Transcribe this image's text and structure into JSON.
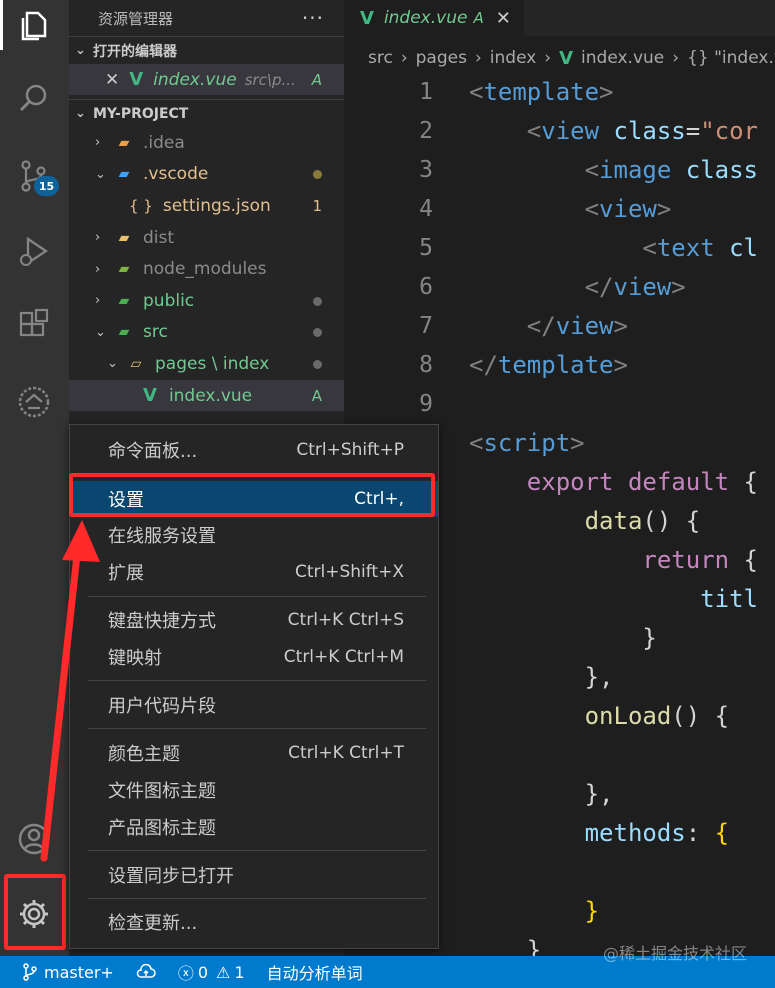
{
  "sidebar": {
    "title": "资源管理器",
    "more": "···",
    "open_editors_label": "打开的编辑器",
    "open_editor": {
      "name": "index.vue",
      "path": "src\\p...",
      "status": "A"
    },
    "project_label": "MY-PROJECT",
    "tree": [
      {
        "name": ".idea",
        "status": ""
      },
      {
        "name": ".vscode",
        "status": ""
      },
      {
        "name": "settings.json",
        "status": "1"
      },
      {
        "name": "dist",
        "status": ""
      },
      {
        "name": "node_modules",
        "status": ""
      },
      {
        "name": "public",
        "status": ""
      },
      {
        "name": "src",
        "status": ""
      },
      {
        "name": "pages \\ index",
        "status": ""
      },
      {
        "name": "index.vue",
        "status": "A"
      }
    ]
  },
  "activity": {
    "scm_badge": "15"
  },
  "editor": {
    "tab": {
      "name": "index.vue",
      "status": "A"
    },
    "breadcrumb": [
      "src",
      "pages",
      "index",
      "index.vue",
      "{} \"index.vue"
    ],
    "line_numbers": [
      "1",
      "2",
      "3",
      "4",
      "5",
      "6",
      "7",
      "8",
      "9"
    ]
  },
  "menu": {
    "items": [
      {
        "label": "命令面板...",
        "shortcut": "Ctrl+Shift+P"
      },
      {
        "label": "设置",
        "shortcut": "Ctrl+,"
      },
      {
        "label": "在线服务设置",
        "shortcut": ""
      },
      {
        "label": "扩展",
        "shortcut": "Ctrl+Shift+X"
      },
      {
        "label": "键盘快捷方式",
        "shortcut": "Ctrl+K Ctrl+S"
      },
      {
        "label": "键映射",
        "shortcut": "Ctrl+K Ctrl+M"
      },
      {
        "label": "用户代码片段",
        "shortcut": ""
      },
      {
        "label": "颜色主题",
        "shortcut": "Ctrl+K Ctrl+T"
      },
      {
        "label": "文件图标主题",
        "shortcut": ""
      },
      {
        "label": "产品图标主题",
        "shortcut": ""
      },
      {
        "label": "设置同步已打开",
        "shortcut": ""
      },
      {
        "label": "检查更新...",
        "shortcut": ""
      }
    ]
  },
  "status": {
    "branch": "master+",
    "errors": "0",
    "warnings": "1",
    "analyze": "自动分析单词"
  },
  "watermark": "@稀土掘金技术社区",
  "colors": {
    "accent": "#007acc",
    "highlight": "#ff2a2a",
    "menu_active": "#094771"
  }
}
